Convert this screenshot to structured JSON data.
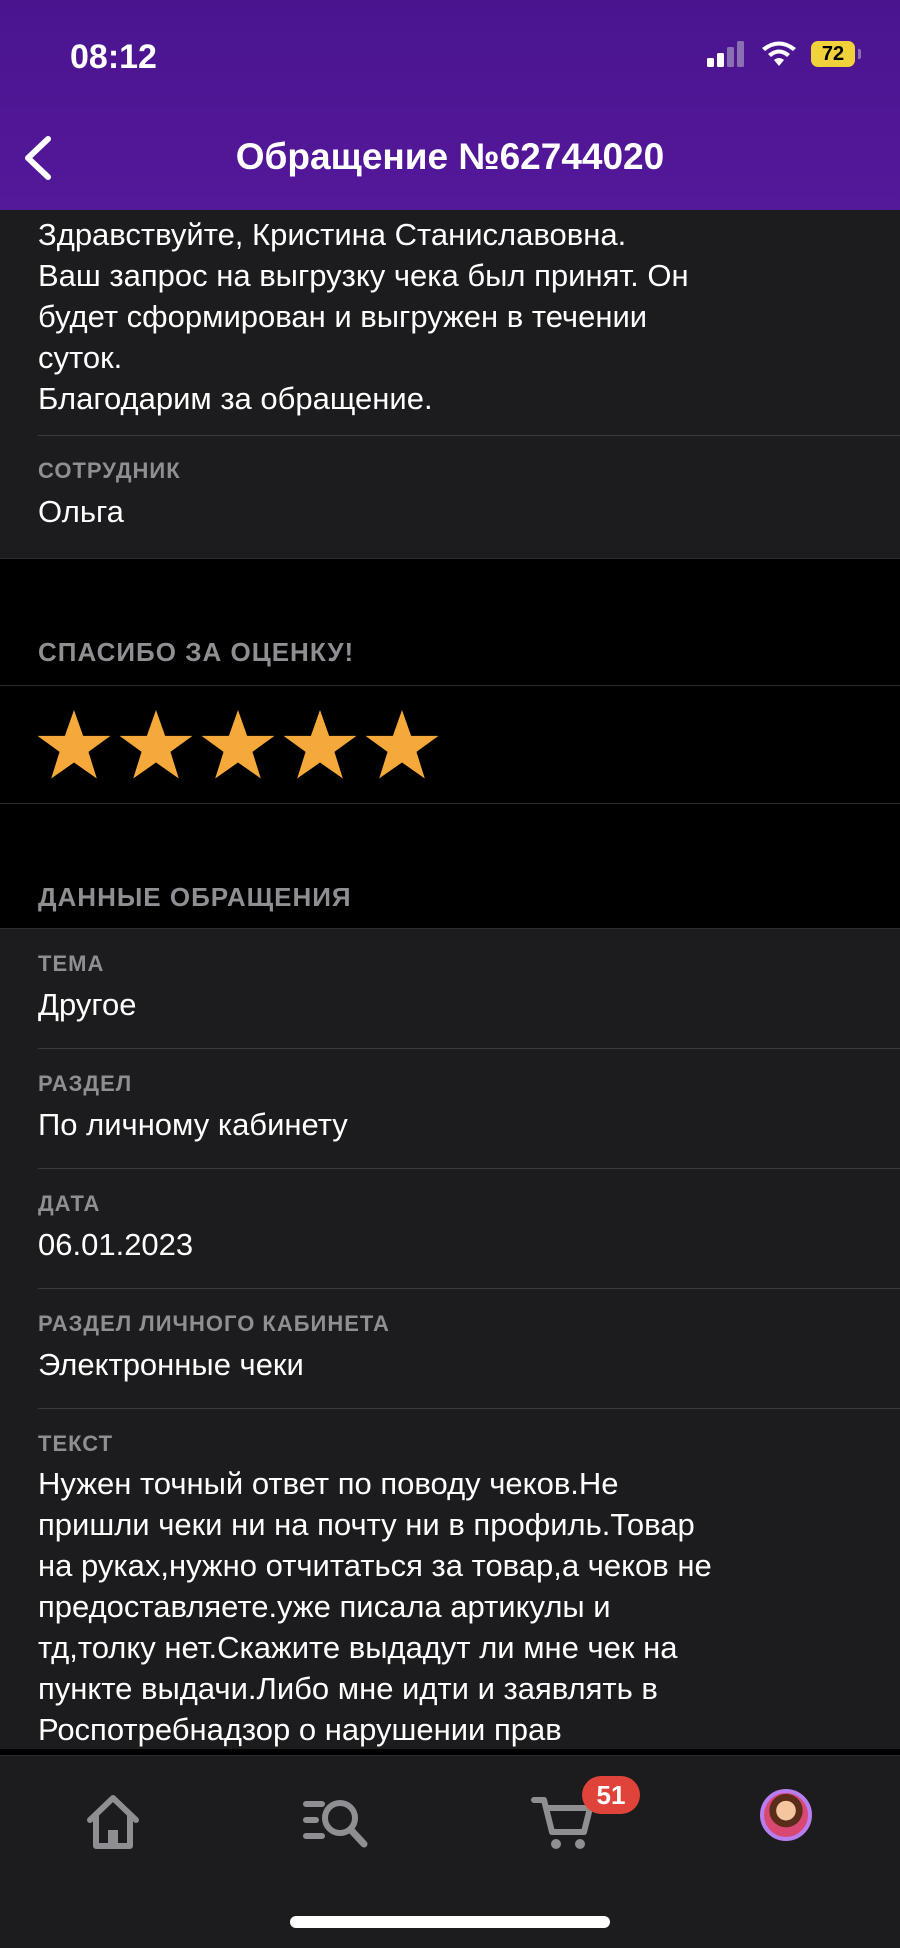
{
  "status_bar": {
    "time": "08:12",
    "battery": "72"
  },
  "header": {
    "title": "Обращение №62744020"
  },
  "reply": {
    "lines": [
      "Здравствуйте, Кристина Станиславовна.",
      "Ваш запрос на выгрузку чека был принят. Он",
      "будет сформирован и выгружен в течении",
      "суток.",
      "Благодарим за обращение."
    ],
    "employee_label": "СОТРУДНИК",
    "employee_name": "Ольга"
  },
  "rating": {
    "header": "СПАСИБО ЗА ОЦЕНКУ!",
    "stars": 5,
    "max": 5,
    "star_color": "#f5a93b"
  },
  "details": {
    "header": "ДАННЫЕ ОБРАЩЕНИЯ",
    "fields": [
      {
        "label": "ТЕМА",
        "value": "Другое"
      },
      {
        "label": "РАЗДЕЛ",
        "value": "По личному кабинету"
      },
      {
        "label": "ДАТА",
        "value": "06.01.2023"
      },
      {
        "label": "РАЗДЕЛ ЛИЧНОГО КАБИНЕТА",
        "value": "Электронные чеки"
      }
    ],
    "text_label": "ТЕКСТ",
    "text_lines": [
      "Нужен точный ответ по поводу чеков.Не",
      "пришли чеки ни на почту ни в профиль.Товар",
      "на руках,нужно отчитаться за товар,а чеков не",
      "предоставляете.уже писала артикулы и",
      "тд,толку нет.Скажите выдадут ли мне чек на",
      "пункте выдачи.Либо мне идти и заявлять в",
      "Роспотребнадзор о нарушении прав"
    ]
  },
  "tabbar": {
    "icons": [
      "home-icon",
      "search-icon",
      "cart-icon",
      "avatar"
    ],
    "cart_badge": "51"
  },
  "colors": {
    "header_purple": "#4f169a",
    "badge_red": "#e0433a",
    "accent_violet": "#b77ef0"
  }
}
